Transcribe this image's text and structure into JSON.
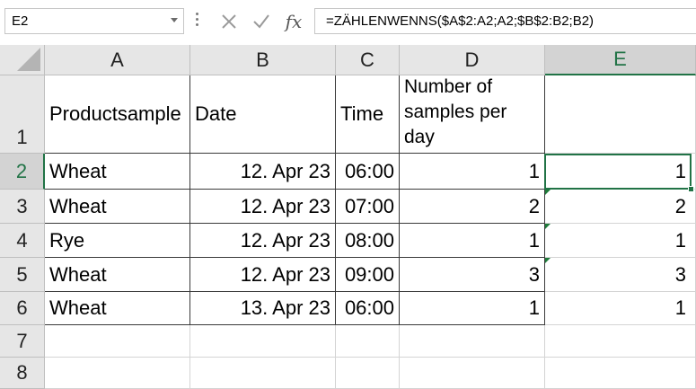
{
  "formula_bar": {
    "name_box": "E2",
    "cancel_icon": "close-icon",
    "enter_icon": "check-icon",
    "fx_label": "fx",
    "formula": "=ZÄHLENWENNS($A$2:A2;A2;$B$2:B2;B2)"
  },
  "columns": [
    "A",
    "B",
    "C",
    "D",
    "E"
  ],
  "rows": [
    "1",
    "2",
    "3",
    "4",
    "5",
    "6",
    "7",
    "8"
  ],
  "selected_cell": "E2",
  "table": {
    "headers": [
      "Productsample",
      "Date",
      "Time",
      "Number of samples per day",
      ""
    ],
    "body": [
      [
        "Wheat",
        "12. Apr 23",
        "06:00",
        "1",
        "1"
      ],
      [
        "Wheat",
        "12. Apr 23",
        "07:00",
        "2",
        "2"
      ],
      [
        "Rye",
        "12. Apr 23",
        "08:00",
        "1",
        "1"
      ],
      [
        "Wheat",
        "12. Apr 23",
        "09:00",
        "3",
        "3"
      ],
      [
        "Wheat",
        "13. Apr 23",
        "06:00",
        "1",
        "1"
      ]
    ]
  },
  "colors": {
    "accent": "#217346",
    "header_bg": "#e6e6e6",
    "selected_header_bg": "#d3d3d3"
  }
}
